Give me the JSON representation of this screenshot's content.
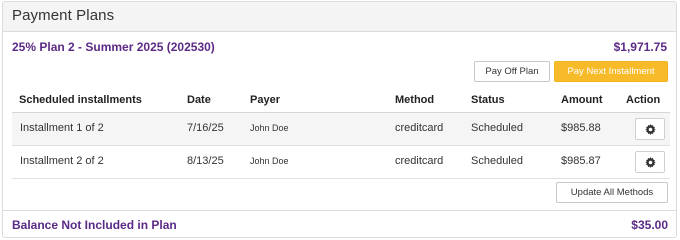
{
  "panel": {
    "title": "Payment Plans"
  },
  "plan": {
    "name": "25% Plan 2 - Summer 2025 (202530)",
    "total": "$1,971.75",
    "pay_off_label": "Pay Off Plan",
    "pay_next_label": "Pay Next Installment"
  },
  "table": {
    "headers": {
      "installment": "Scheduled installments",
      "date": "Date",
      "payer": "Payer",
      "method": "Method",
      "status": "Status",
      "amount": "Amount",
      "action": "Action"
    },
    "rows": [
      {
        "installment": "Installment 1 of 2",
        "date": "7/16/25",
        "payer": "John Doe",
        "method": "creditcard",
        "status": "Scheduled",
        "amount": "$985.88",
        "action_icon": "gear-icon"
      },
      {
        "installment": "Installment 2 of 2",
        "date": "8/13/25",
        "payer": "John Doe",
        "method": "creditcard",
        "status": "Scheduled",
        "amount": "$985.87",
        "action_icon": "gear-icon"
      }
    ]
  },
  "update_methods_label": "Update All Methods",
  "balance": {
    "label": "Balance Not Included in Plan",
    "amount": "$35.00"
  },
  "colors": {
    "accent_purple": "#5b2a86",
    "pay_next_yellow": "#f7bb2a",
    "header_bg": "#f4f4f4"
  }
}
